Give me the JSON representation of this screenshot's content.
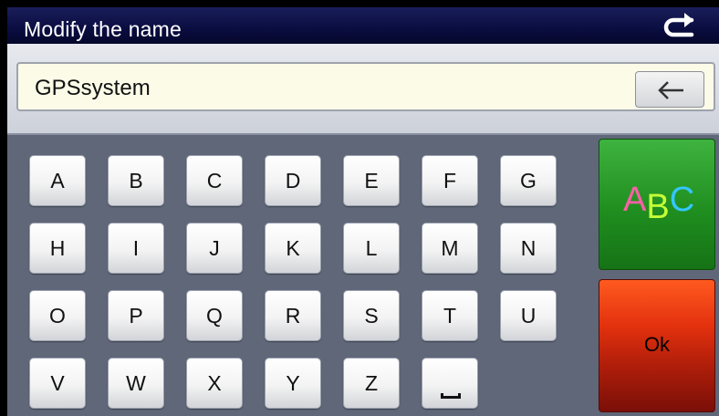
{
  "header": {
    "title": "Modify the name",
    "back_icon": "return-arrow-icon"
  },
  "name_input": {
    "value": "GPSsystem",
    "backspace_icon": "left-arrow-icon"
  },
  "keyboard": {
    "rows": [
      [
        "A",
        "B",
        "C",
        "D",
        "E",
        "F",
        "G"
      ],
      [
        "H",
        "I",
        "J",
        "K",
        "L",
        "M",
        "N"
      ],
      [
        "O",
        "P",
        "Q",
        "R",
        "S",
        "T",
        "U"
      ],
      [
        "V",
        "W",
        "X",
        "Y",
        "Z"
      ]
    ],
    "space_key_icon": "space-bar-icon"
  },
  "side_buttons": {
    "mode_label_parts": [
      "A",
      "B",
      "C"
    ],
    "mode_colors": [
      "#ff5fa8",
      "#c6ff36",
      "#33c7ff"
    ],
    "ok_label": "Ok"
  },
  "colors": {
    "title_bar": "#0a0d40",
    "input_background": "#fbfbe8",
    "mode_button": "#1f8e1f",
    "ok_button": "#e3310e"
  }
}
